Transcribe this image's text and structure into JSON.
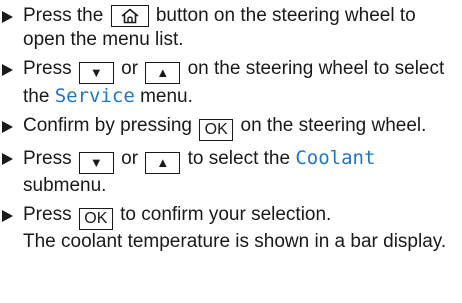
{
  "steps": [
    {
      "before": "Press the",
      "key": "home-icon",
      "after": "button on the steering wheel to open the menu list."
    },
    {
      "before": "Press",
      "key1": "▼",
      "between": "or",
      "key2": "▲",
      "after": "on the steering wheel to select the",
      "menu": "Service",
      "end": "menu."
    },
    {
      "before": "Confirm by pressing",
      "key": "OK",
      "after": "on the steering wheel."
    },
    {
      "before": "Press",
      "key1": "▼",
      "between": "or",
      "key2": "▲",
      "after": "to select the",
      "menu": "Coolant",
      "end": "submenu."
    },
    {
      "before": "Press",
      "key": "OK",
      "after": "to confirm your selection.",
      "result": "The coolant temperature is shown in a bar display."
    }
  ]
}
